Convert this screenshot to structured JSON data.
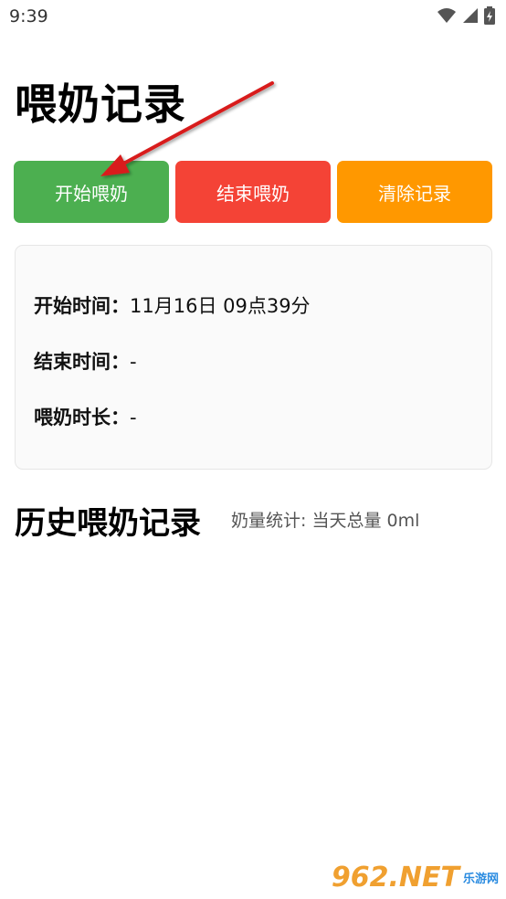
{
  "status": {
    "time": "9:39"
  },
  "title": "喂奶记录",
  "buttons": [
    {
      "label": "开始喂奶",
      "color": "#4CAF50"
    },
    {
      "label": "结束喂奶",
      "color": "#F44336"
    },
    {
      "label": "清除记录",
      "color": "#FF9800"
    }
  ],
  "card": {
    "start_label": "开始时间：",
    "start_value": "11月16日 09点39分",
    "end_label": "结束时间：",
    "end_value": "-",
    "duration_label": "喂奶时长：",
    "duration_value": "-"
  },
  "history": {
    "title": "历史喂奶记录",
    "stats": "奶量统计: 当天总量 0ml"
  },
  "watermark": {
    "main": "962.NET",
    "sub": "乐游网"
  },
  "icons": [
    "wifi-icon",
    "signal-icon",
    "battery-icon",
    "annotation-arrow-icon"
  ]
}
